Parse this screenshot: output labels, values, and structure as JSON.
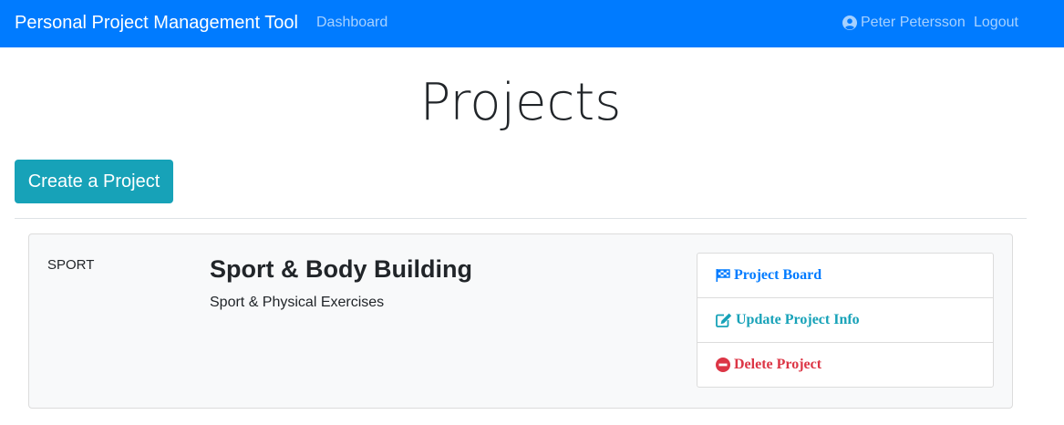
{
  "navbar": {
    "brand": "Personal Project Management Tool",
    "dashboard": "Dashboard",
    "user": "Peter Petersson",
    "logout": "Logout",
    "color": "#007bff"
  },
  "page": {
    "title": "Projects",
    "create_button": "Create a Project"
  },
  "projects": [
    {
      "identifier": "SPORT",
      "name": "Sport & Body Building",
      "description": "Sport & Physical Exercises",
      "actions": {
        "board": "Project Board",
        "update": "Update Project Info",
        "delete": "Delete Project"
      }
    }
  ],
  "icons": {
    "user": "user-circle-icon",
    "board": "flag-checkered-icon",
    "update": "edit-icon",
    "delete": "minus-circle-icon"
  },
  "colors": {
    "primary": "#007bff",
    "info": "#17a2b8",
    "danger": "#dc3545"
  }
}
